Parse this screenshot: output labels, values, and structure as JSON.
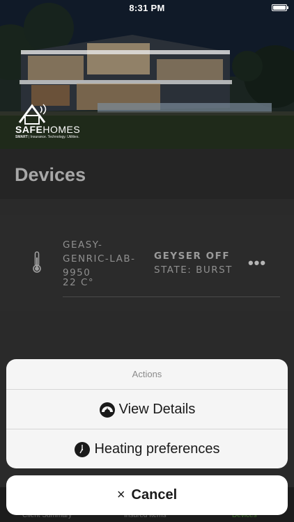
{
  "status_bar": {
    "time": "8:31 PM"
  },
  "brand": {
    "name_bold": "SAFE",
    "name_regular": "HOMES",
    "tagline_bold": "SMART",
    "tagline_rest": " | Insurance. Technology. Utilities."
  },
  "page": {
    "title": "Devices"
  },
  "device": {
    "name": "GEASY-GENRIC-LAB-9950",
    "temperature": "22 C°",
    "status": "GEYSER OFF",
    "state": "STATE: BURST",
    "more_label": "•••"
  },
  "tabs": [
    {
      "label": "Client Summary"
    },
    {
      "label": "Insured Items"
    },
    {
      "label": "Devices"
    }
  ],
  "action_sheet": {
    "title": "Actions",
    "view_details": "View Details",
    "heating_preferences": "Heating preferences",
    "cancel": "Cancel",
    "cancel_glyph": "×"
  },
  "colors": {
    "accent_tab": "#3c6e2a",
    "sheet_bg": "#f5f5f5",
    "title_color": "#a7a7a7"
  }
}
